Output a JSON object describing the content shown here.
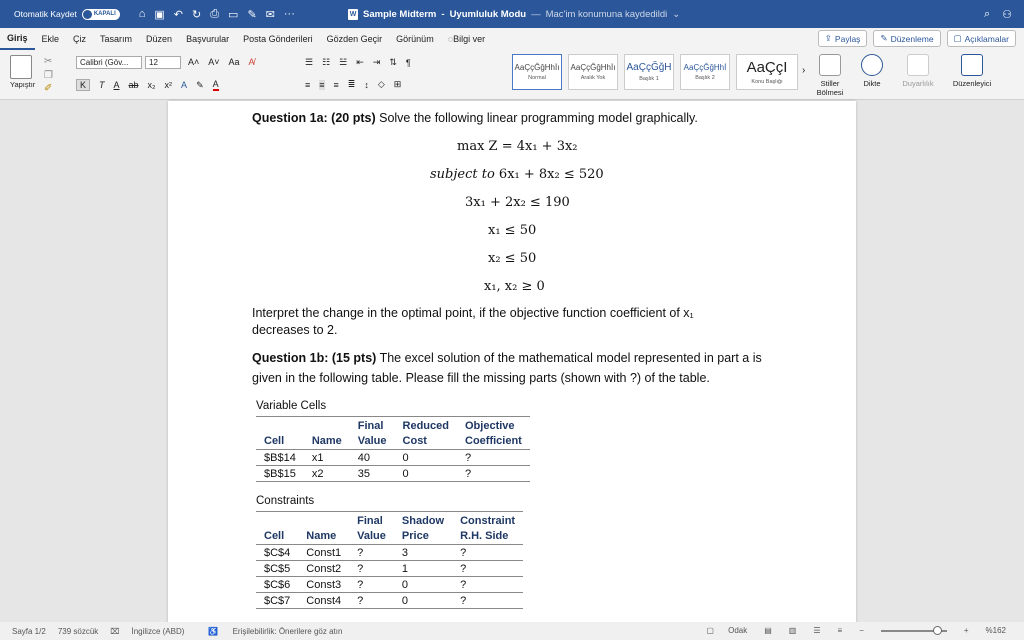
{
  "titlebar": {
    "autosave_label": "Otomatik Kaydet",
    "autosave_state": "KAPALI",
    "doc_title": "Sample Midterm",
    "separator": "-",
    "mode": "Uyumluluk Modu",
    "dash": "—",
    "saved_status": "Mac'im konumuna kaydedildi"
  },
  "menu": {
    "tabs": [
      "Giriş",
      "Ekle",
      "Çiz",
      "Tasarım",
      "Düzen",
      "Başvurular",
      "Posta Gönderileri",
      "Gözden Geçir",
      "Görünüm",
      "Bilgi ver"
    ],
    "share": "Paylaş",
    "editing": "Düzenleme",
    "comments": "Açıklamalar"
  },
  "ribbon": {
    "paste": "Yapıştır",
    "font_name": "Calibri (Göv...",
    "font_size": "12",
    "styles": [
      {
        "sample": "AaÇçĞğHhİı",
        "name": "Normal"
      },
      {
        "sample": "AaÇçĞğHhİı",
        "name": "Aralık Yok"
      },
      {
        "sample": "AaÇçĞğH",
        "name": "Başlık 1"
      },
      {
        "sample": "AaÇçĞğHhİ",
        "name": "Başlık 2"
      },
      {
        "sample": "AaÇçI",
        "name": "Konu Başlığı"
      }
    ],
    "styles_pane": "Stiller Bölmesi",
    "dictate": "Dikte",
    "sensitivity": "Duyarlılık",
    "editor": "Düzenleyici"
  },
  "document": {
    "q1a_bold": "Question 1a: (20 pts)",
    "q1a_text": " Solve the following linear programming model graphically.",
    "objective": "max Z = 4x₁ + 3x₂",
    "subject_to": "subject to",
    "c1": "6x₁ + 8x₂ ≤ 520",
    "c2": "3x₁ + 2x₂ ≤ 190",
    "c3": "x₁ ≤ 50",
    "c4": "x₂ ≤ 50",
    "c5": "x₁, x₂ ≥ 0",
    "interpret_1": "Interpret the change in the optimal point, if the objective function coefficient of x₁",
    "interpret_2": "decreases to 2.",
    "q1b_bold": "Question 1b: (15 pts)",
    "q1b_text_1": " The excel solution of the mathematical model represented in part a is",
    "q1b_text_2": "given in the following table. Please fill the missing parts (shown with ?) of the table.",
    "variable_cells_title": "Variable Cells",
    "var_headers": [
      [
        "",
        "",
        "Final",
        "Reduced",
        "Objective"
      ],
      [
        "Cell",
        "Name",
        "Value",
        "Cost",
        "Coefficient"
      ]
    ],
    "var_rows": [
      [
        "$B$14",
        "x1",
        "40",
        "0",
        "?"
      ],
      [
        "$B$15",
        "x2",
        "35",
        "0",
        "?"
      ]
    ],
    "constraints_title": "Constraints",
    "con_headers": [
      [
        "",
        "",
        "Final",
        "Shadow",
        "Constraint"
      ],
      [
        "Cell",
        "Name",
        "Value",
        "Price",
        "R.H. Side"
      ]
    ],
    "con_rows": [
      [
        "$C$4",
        "Const1",
        "?",
        "3",
        "?"
      ],
      [
        "$C$5",
        "Const2",
        "?",
        "1",
        "?"
      ],
      [
        "$C$6",
        "Const3",
        "?",
        "0",
        "?"
      ],
      [
        "$C$7",
        "Const4",
        "?",
        "0",
        "?"
      ]
    ]
  },
  "status": {
    "page": "Sayfa 1/2",
    "words": "739 sözcük",
    "language": "İngilizce (ABD)",
    "accessibility": "Erişilebilirlik: Önerilere göz atın",
    "focus": "Odak",
    "zoom": "%162"
  }
}
